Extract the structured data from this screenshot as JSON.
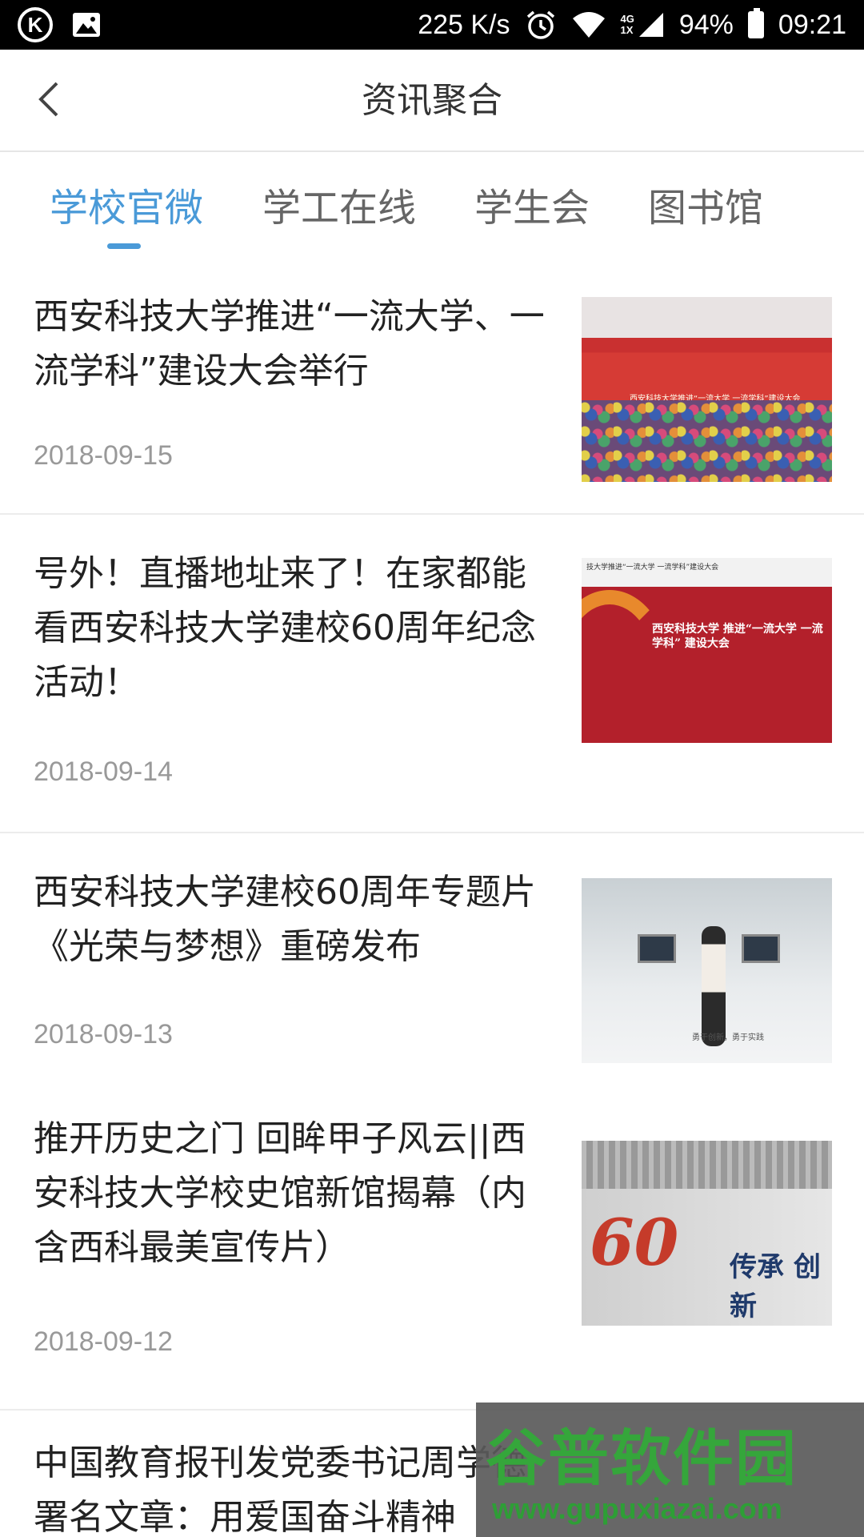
{
  "status_bar": {
    "net_speed": "225 K/s",
    "signal_text_top": "4G",
    "signal_text_bottom": "1X",
    "battery": "94%",
    "time": "09:21"
  },
  "header": {
    "title": "资讯聚合"
  },
  "tabs": [
    {
      "label": "学校官微",
      "active": true
    },
    {
      "label": "学工在线",
      "active": false
    },
    {
      "label": "学生会",
      "active": false
    },
    {
      "label": "图书馆",
      "active": false
    }
  ],
  "news": [
    {
      "title": "西安科技大学推进“一流大学、一流学科”建设大会举行",
      "date": "2018-09-15"
    },
    {
      "title": "号外！直播地址来了！在家都能看西安科技大学建校60周年纪念活动！",
      "date": "2018-09-14"
    },
    {
      "title": "西安科技大学建校60周年专题片《光荣与梦想》重磅发布",
      "date": "2018-09-13"
    },
    {
      "title": "推开历史之门 回眸甲子风云||西安科技大学校史馆新馆揭幕（内含西科最美宣传片）",
      "date": "2018-09-12"
    },
    {
      "title": "中国教育报刊发党委书记周学德署名文章：用爱国奋斗精神",
      "date": ""
    }
  ],
  "thumbs": {
    "t1_banner": "西安科技大学推进“一流大学 一流学科”建设大会",
    "t2_top": "技大学推进“一流大学 一流学科”建设大会",
    "t2_text": "西安科技大学 推进“一流大学 一流学科” 建设大会",
    "t3_caption": "勇于创新，勇于实践",
    "t4_logo": "60",
    "t4_callig": "传承 创新"
  },
  "watermark": {
    "title": "谷普软件园",
    "url": "www.gupuxiazai.com"
  },
  "colors": {
    "accent": "#4a9ad8",
    "divider": "#ececec",
    "date": "#999999"
  }
}
